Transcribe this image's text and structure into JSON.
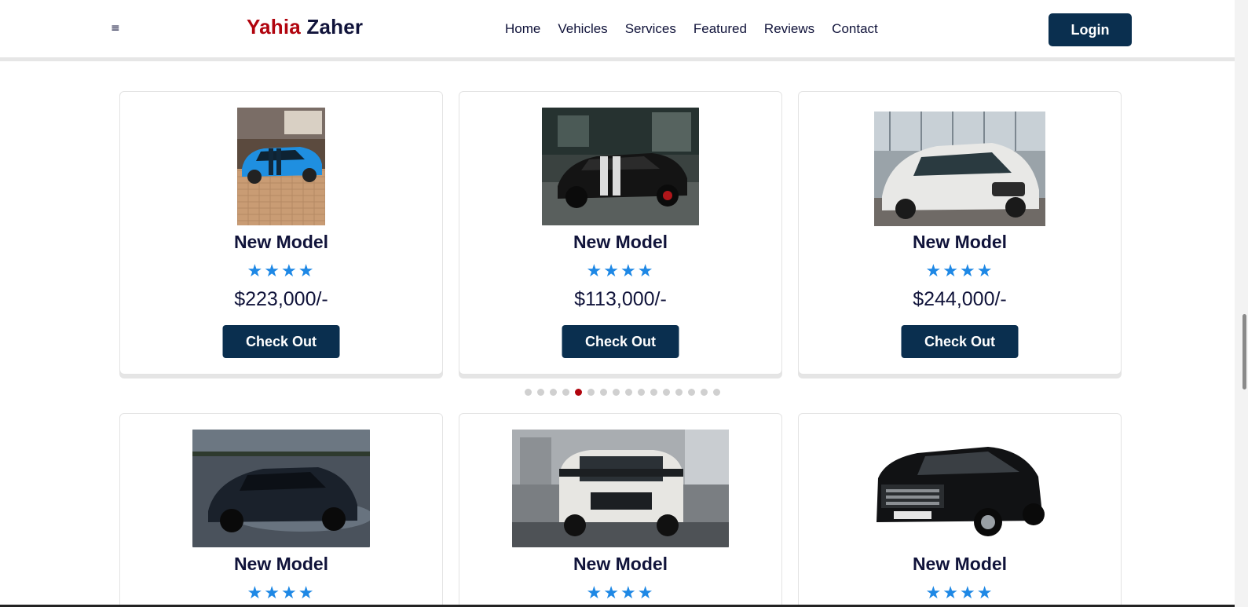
{
  "header": {
    "logo_first": "Yahia",
    "logo_last": "Zaher",
    "nav": [
      "Home",
      "Vehicles",
      "Services",
      "Featured",
      "Reviews",
      "Contact"
    ],
    "login_label": "Login",
    "menu_icon": "≡"
  },
  "colors": {
    "accent_red": "#b1040e",
    "navy": "#0a2f4f",
    "star_blue": "#1e88e5",
    "text_dark": "#10133a"
  },
  "cards_row1": [
    {
      "title": "New Model",
      "stars": "★★★★",
      "price": "$223,000/-",
      "button": "Check Out",
      "image": "blue-sports-car"
    },
    {
      "title": "New Model",
      "stars": "★★★★",
      "price": "$113,000/-",
      "button": "Check Out",
      "image": "black-muscle-car"
    },
    {
      "title": "New Model",
      "stars": "★★★★",
      "price": "$244,000/-",
      "button": "Check Out",
      "image": "white-concept-car"
    }
  ],
  "cards_row2": [
    {
      "title": "New Model",
      "stars": "★★★★",
      "image": "dark-hypercar"
    },
    {
      "title": "New Model",
      "stars": "★★★★",
      "image": "white-suv-g-class"
    },
    {
      "title": "New Model",
      "stars": "★★★★",
      "image": "black-land-cruiser"
    }
  ],
  "carousel": {
    "total_dots": 16,
    "active_index": 4
  }
}
